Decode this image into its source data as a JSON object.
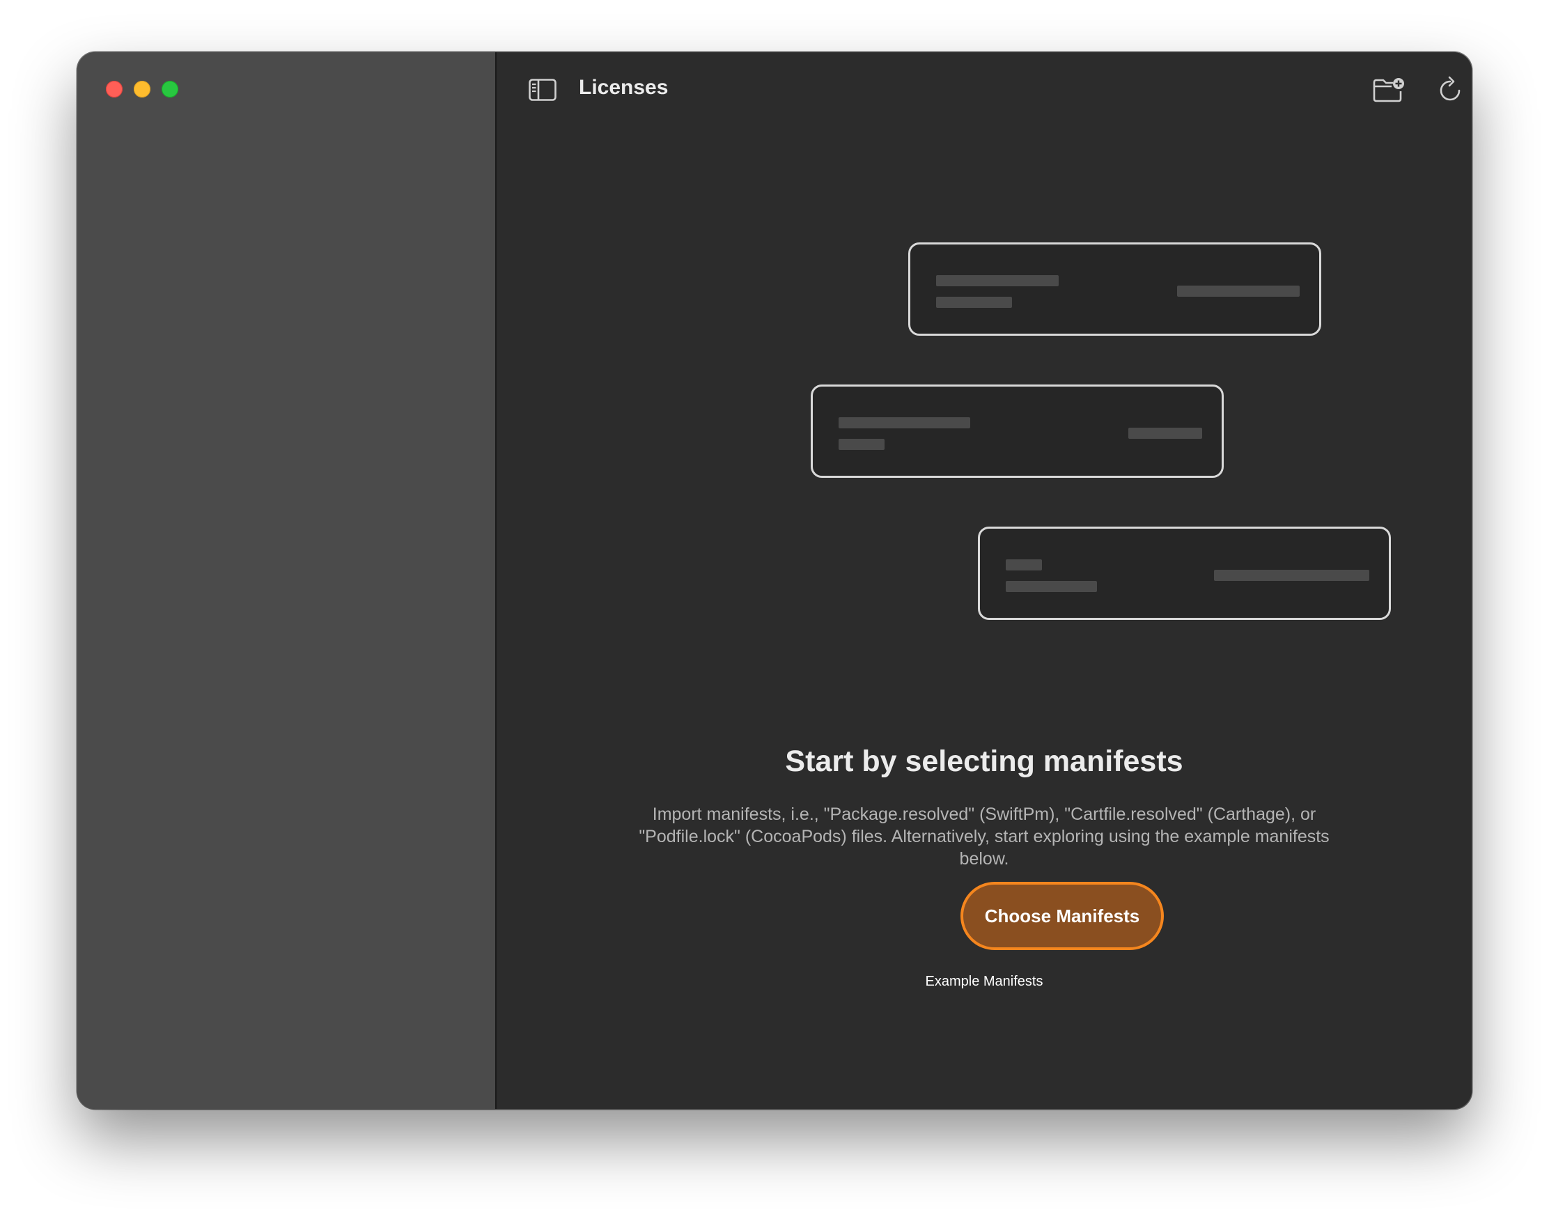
{
  "window": {
    "title": "Licenses",
    "traffic_lights": [
      "close",
      "minimize",
      "zoom"
    ]
  },
  "toolbar": {
    "sidebar_toggle_icon": "sidebar-left-icon",
    "actions": [
      {
        "icon": "folder-badge-plus-icon",
        "name": "add-manifests"
      },
      {
        "icon": "refresh-icon",
        "name": "reload"
      },
      {
        "icon": "share-icon",
        "name": "share"
      }
    ]
  },
  "empty_state": {
    "headline": "Start by selecting manifests",
    "description": "Import manifests, i.e., \"Package.resolved\" (SwiftPm), \"Cartfile.resolved\" (Carthage), or \"Podfile.lock\" (CocoaPods) files. Alternatively, start exploring using the example manifests below.",
    "primary_button": "Choose Manifests",
    "secondary_link": "Example Manifests"
  },
  "colors": {
    "accent": "#f5861e",
    "button_fill": "#8a4f20",
    "sidebar_bg": "#4b4b4b",
    "content_bg": "#2c2c2c"
  }
}
